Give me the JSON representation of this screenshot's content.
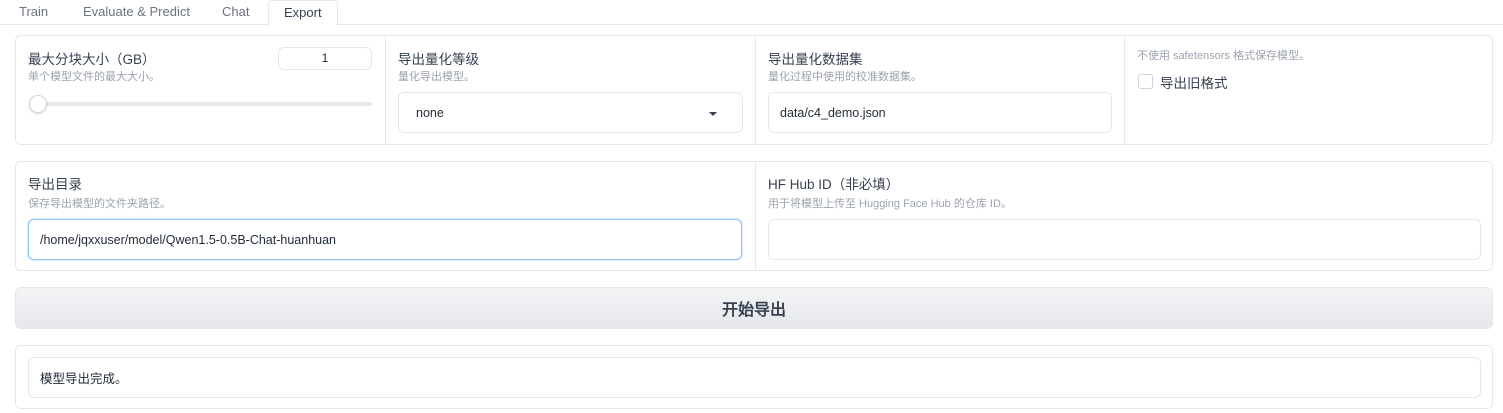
{
  "tabs": [
    {
      "label": "Train"
    },
    {
      "label": "Evaluate & Predict"
    },
    {
      "label": "Chat"
    },
    {
      "label": "Export"
    }
  ],
  "row1": {
    "max_shard": {
      "label": "最大分块大小（GB）",
      "info": "单个模型文件的最大大小。",
      "value": "1",
      "slider_level": 1
    },
    "quant_bit": {
      "label": "导出量化等级",
      "info": "量化导出模型。",
      "selected": "none"
    },
    "quant_dataset": {
      "label": "导出量化数据集",
      "info": "量化过程中使用的校准数据集。",
      "value": "data/c4_demo.json"
    },
    "legacy": {
      "info": "不使用 safetensors 格式保存模型。",
      "checkbox_label": "导出旧格式",
      "checked": false
    }
  },
  "row2": {
    "export_dir": {
      "label": "导出目录",
      "info": "保存导出模型的文件夹路径。",
      "value": "/home/jqxxuser/model/Qwen1.5-0.5B-Chat-huanhuan"
    },
    "hub_id": {
      "label": "HF Hub ID（非必填）",
      "info": "用于将模型上传至 Hugging Face Hub 的仓库 ID。",
      "value": ""
    }
  },
  "export_button": {
    "label": "开始导出"
  },
  "status": {
    "value": "模型导出完成。"
  }
}
